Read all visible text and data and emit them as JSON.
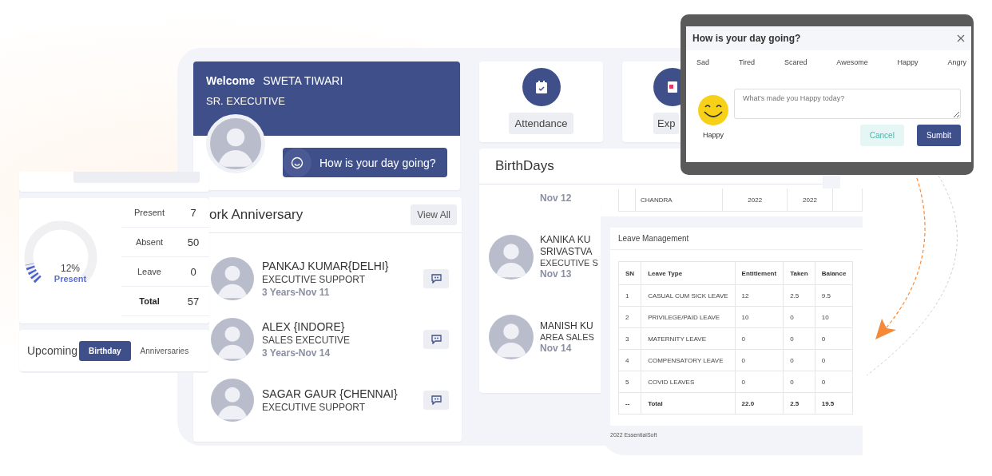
{
  "welcome": {
    "greeting": "Welcome",
    "name": "SWETA TIWARI",
    "designation": "SR. EXECUTIVE",
    "mood_button": "How is your day going?"
  },
  "work_anniversary": {
    "title": "ork Anniversary",
    "view_all": "View All",
    "people": [
      {
        "name": "PANKAJ KUMAR{DELHI}",
        "role": "EXECUTIVE SUPPORT",
        "tenure": "3 Years-Nov 11"
      },
      {
        "name": "ALEX {INDORE}",
        "role": "SALES EXECUTIVE",
        "tenure": "3 Years-Nov 14"
      },
      {
        "name": "SAGAR GAUR {CHENNAI}",
        "role": "EXECUTIVE SUPPORT"
      }
    ]
  },
  "quick_links": [
    {
      "label": "Attendance",
      "kind": "calendar"
    },
    {
      "label": "Exp",
      "kind": "document"
    }
  ],
  "birthdays": {
    "title": "BirthDays",
    "people": [
      {
        "date": "Nov 12"
      },
      {
        "names": [
          "KANIKA KU",
          "SRIVASTVA"
        ],
        "role": "EXECUTIVE S",
        "date": "Nov 13"
      },
      {
        "names": [
          "MANISH KU"
        ],
        "role": "AREA SALES",
        "date": "Nov 14"
      }
    ]
  },
  "attendance_summary": {
    "percent": "12%",
    "caption": "Present",
    "level": 0.12,
    "rows": [
      {
        "label": "Present",
        "value": "7",
        "kind": "count"
      },
      {
        "label": "Absent",
        "value": "50",
        "kind": "count"
      },
      {
        "label": "Leave",
        "value": "0",
        "kind": "count"
      },
      {
        "label": "Total",
        "value": "57",
        "kind": "total"
      }
    ]
  },
  "upcoming": {
    "title": "Upcoming",
    "tabs": [
      {
        "label": "Birthday",
        "selected": true
      },
      {
        "label": "Anniversaries",
        "selected": false
      }
    ]
  },
  "year_table": {
    "cells": [
      "CHANDRA",
      "2022",
      "2022"
    ]
  },
  "leave_management": {
    "title": "Leave Management",
    "columns": [
      "SN",
      "Leave Type",
      "Entitlement",
      "Taken",
      "Balance"
    ],
    "rows": [
      [
        "1",
        "CASUAL CUM SICK LEAVE",
        "12",
        "2.5",
        "9.5"
      ],
      [
        "2",
        "PRIVILEGE/PAID LEAVE",
        "10",
        "0",
        "10"
      ],
      [
        "3",
        "MATERNITY LEAVE",
        "0",
        "0",
        "0"
      ],
      [
        "4",
        "COMPENSATORY LEAVE",
        "0",
        "0",
        "0"
      ],
      [
        "5",
        "COVID LEAVES",
        "0",
        "0",
        "0"
      ]
    ],
    "total": [
      "--",
      "Total",
      "22.0",
      "2.5",
      "19.5"
    ]
  },
  "footer": "2022 EssentialSoft",
  "mood_dialog": {
    "title": "How is your day going?",
    "moods": [
      {
        "label": "Sad"
      },
      {
        "label": "Tired"
      },
      {
        "label": "Scared"
      },
      {
        "label": "Awesome"
      },
      {
        "label": "Happy"
      },
      {
        "label": "Angry"
      }
    ],
    "current_mood": "Happy",
    "placeholder": "What's made you Happy today?",
    "buttons": [
      {
        "label": "Cancel",
        "kind": "secondary"
      },
      {
        "label": "Sumbit",
        "kind": "primary"
      }
    ]
  }
}
